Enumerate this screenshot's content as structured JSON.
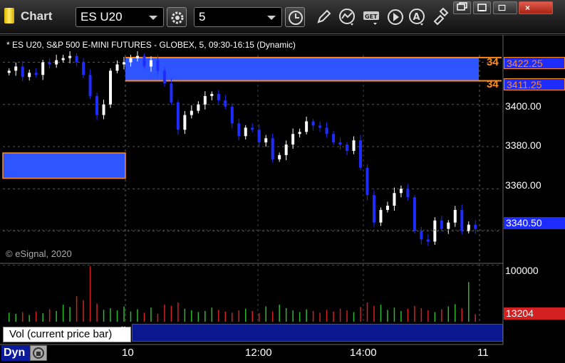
{
  "window": {
    "title": "Chart"
  },
  "toolbar": {
    "symbol": "ES U20",
    "interval": "5",
    "icons": [
      "settings-gear-icon",
      "clock-icon",
      "pencil-draw-icon",
      "study-curve-icon",
      "get-data-icon",
      "play-icon",
      "alert-a-icon",
      "cursor-icon",
      "restore-icon",
      "minimize-icon",
      "maximize-icon",
      "close-icon"
    ]
  },
  "chart": {
    "title": "* ES U20, S&P 500 E-MINI FUTURES - GLOBEX, 5, 09:30-16:15 (Dynamic)",
    "copyright": "© eSignal, 2020",
    "colors": {
      "background": "#000000",
      "up_candle": "#ffffff",
      "down_candle": "#1f2cff",
      "zone_fill": "#2e55ff",
      "zone_border": "#ff8c1a",
      "vol_up": "#2db82d",
      "vol_down": "#d42020",
      "price_tag_bg": "#1f2cff",
      "vol_tag_bg": "#d42020"
    },
    "price_axis": {
      "ticks": [
        "3400.00",
        "3380.00",
        "3360.00"
      ],
      "values": [
        3400,
        3380,
        3360
      ],
      "range": [
        3325,
        3433
      ]
    },
    "zones": [
      {
        "tag": "34",
        "price_label": "3422.25",
        "price": 3422.25
      },
      {
        "tag": "34",
        "price_label": "3411.25",
        "price": 3411.25
      }
    ],
    "left_zone": {
      "top": 3377,
      "bottom": 3365
    },
    "last_price": {
      "label": "3340.50",
      "value": 3340.5
    },
    "time_axis": {
      "ticks": [
        "10",
        "12:00",
        "14:00",
        "11"
      ]
    }
  },
  "volume": {
    "label": "Vol (current price bar)",
    "close_symbol": "×",
    "axis_tick": "100000",
    "last": "13204",
    "scale_max": 100000
  },
  "status_bar": {
    "mode": "Dyn"
  },
  "chart_data": {
    "type": "candlestick",
    "title": "* ES U20, S&P 500 E-MINI FUTURES - GLOBEX, 5, 09:30-16:15 (Dynamic)",
    "xlabel": "",
    "ylabel": "",
    "x_ticks": [
      "10",
      "12:00",
      "14:00",
      "11"
    ],
    "y_ticks": [
      3400,
      3380,
      3360
    ],
    "ylim": [
      3325,
      3433
    ],
    "last_price": 3340.5,
    "zone_prices": [
      3422.25,
      3411.25
    ],
    "close_path": [
      3416,
      3418,
      3413,
      3415,
      3414,
      3420,
      3419,
      3421,
      3422,
      3423,
      3420,
      3414,
      3404,
      3395,
      3400,
      3416,
      3419,
      3420,
      3422,
      3423,
      3418,
      3421,
      3416,
      3410,
      3401,
      3388,
      3395,
      3397,
      3400,
      3404,
      3405,
      3402,
      3399,
      3391,
      3385,
      3389,
      3388,
      3382,
      3384,
      3374,
      3376,
      3381,
      3386,
      3387,
      3392,
      3390,
      3389,
      3386,
      3382,
      3381,
      3378,
      3383,
      3370,
      3357,
      3344,
      3350,
      3352,
      3358,
      3360,
      3356,
      3340,
      3336,
      3335,
      3345,
      3341,
      3344,
      3350,
      3340,
      3343,
      3341
    ],
    "volume_values": [
      16000,
      14000,
      17000,
      12000,
      18000,
      15000,
      22000,
      19000,
      30000,
      26000,
      45000,
      38000,
      98000,
      32000,
      21000,
      24000,
      20000,
      27000,
      18000,
      22000,
      16000,
      25000,
      14000,
      30000,
      28000,
      34000,
      23000,
      20000,
      17000,
      19000,
      25000,
      21000,
      18000,
      16000,
      20000,
      23000,
      19000,
      15000,
      27000,
      18000,
      30000,
      24000,
      20000,
      17000,
      22000,
      19000,
      16000,
      21000,
      18000,
      23000,
      20000,
      17000,
      26000,
      34000,
      28000,
      30000,
      21000,
      25000,
      19000,
      23000,
      28000,
      24000,
      20000,
      17000,
      22000,
      27000,
      31000,
      24000,
      70000,
      13204
    ]
  }
}
